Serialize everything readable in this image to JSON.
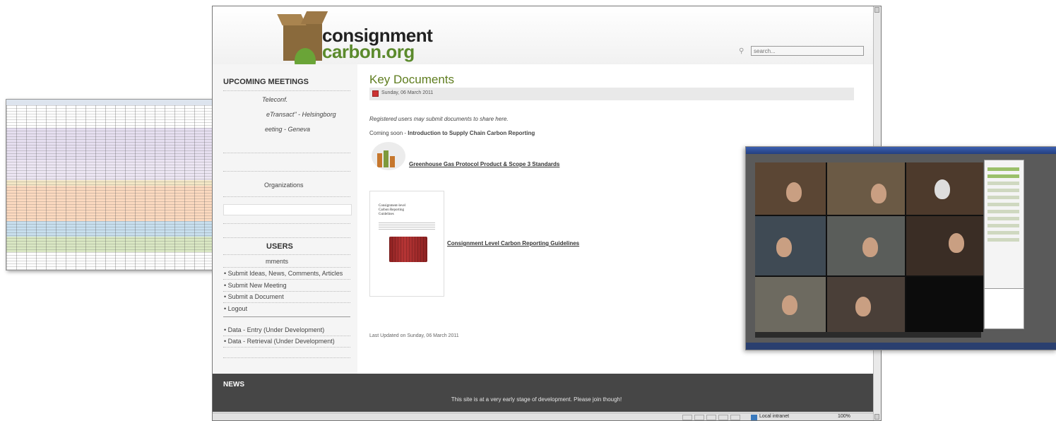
{
  "site": {
    "logo_line1": "consignment",
    "logo_line2": "carbon.org",
    "search_placeholder": "search..."
  },
  "sidebar": {
    "upcoming_heading": "UPCOMING MEETINGS",
    "meetings": [
      "Teleconf.",
      "eTransact\" - Helsingborg",
      "eeting - Geneva"
    ],
    "partial_item": "Organizations",
    "users_heading": "USERS",
    "user_items": [
      "mments",
      "Submit Ideas, News, Comments, Articles",
      "Submit New Meeting",
      "Submit a Document",
      "Logout"
    ],
    "separator": "----------------------------------------",
    "data_items": [
      "Data - Entry (Under Development)",
      "Data - Retrieval (Under Development)"
    ]
  },
  "main": {
    "title": "Key Documents",
    "date": "Sunday, 06 March 2011",
    "intro": "Registered users may submit documents to share here.",
    "coming_soon_prefix": "Coming soon -",
    "coming_soon_title": "Introduction to Supply Chain Carbon Reporting",
    "doc1_link": "Greenhouse Gas Protocol Product & Scope 3 Standards",
    "doc2_thumb_title": "Consignment-level\nCarbon Reporting\nGuidelines",
    "doc2_link": "Consignment Level Carbon Reporting Guidelines",
    "last_updated": "Last Updated on Sunday, 06 March 2011"
  },
  "news": {
    "heading": "NEWS",
    "text": "This site is at a very early stage of development. Please join though!"
  },
  "statusbar": {
    "zone": "Local intranet",
    "zoom": "100%"
  },
  "colors": {
    "title_green": "#5f7d1f",
    "news_bg": "#464646",
    "sidebar_bg": "#f5f5f5"
  }
}
